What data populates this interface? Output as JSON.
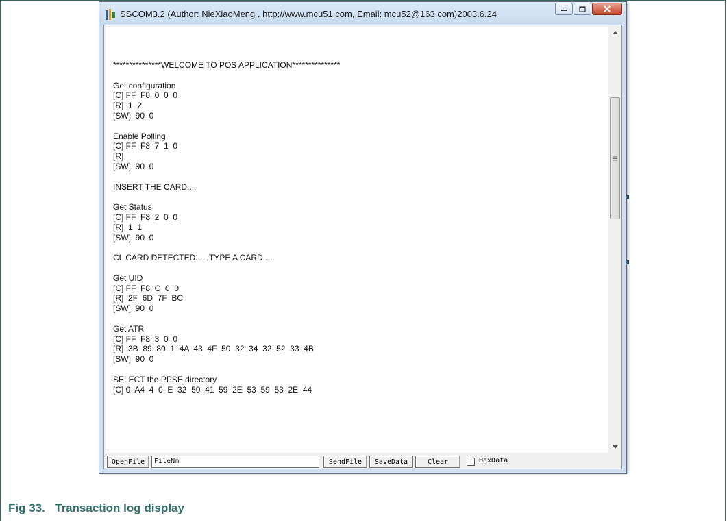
{
  "window": {
    "title": "SSCOM3.2 (Author: NieXiaoMeng .  http://www.mcu51.com,  Email: mcu52@163.com)2003.6.24"
  },
  "log_lines": [
    "***************WELCOME TO POS APPLICATION***************",
    "",
    "Get configuration",
    "[C] FF  F8  0  0  0",
    "[R]  1  2",
    "[SW]  90  0",
    "",
    "Enable Polling",
    "[C] FF  F8  7  1  0",
    "[R]",
    "[SW]  90  0",
    "",
    "INSERT THE CARD....",
    "",
    "Get Status",
    "[C] FF  F8  2  0  0",
    "[R]  1  1",
    "[SW]  90  0",
    "",
    "CL CARD DETECTED..... TYPE A CARD.....",
    "",
    "Get UID",
    "[C] FF  F8  C  0  0",
    "[R]  2F  6D  7F  BC",
    "[SW]  90  0",
    "",
    "Get ATR",
    "[C] FF  F8  3  0  0",
    "[R]  3B  89  80  1  4A  43  4F  50  32  34  32  52  33  4B",
    "[SW]  90  0",
    "",
    "SELECT the PPSE directory",
    "[C] 0  A4  4  0  E  32  50  41  59  2E  53  59  53  2E  44"
  ],
  "toolbar": {
    "open_file": "OpenFile",
    "file_name_value": "FileNm",
    "send_file": "SendFile",
    "save_data": "SaveData",
    "clear": "Clear",
    "hex_data": "HexData",
    "hex_data_checked": false
  },
  "caption": "Fig 33.   Transaction log display",
  "colors": {
    "caption": "#2e6f67",
    "frame": "#2f6b63",
    "close_button": "#c9432c"
  },
  "icons": [
    "app-icon",
    "minimize-icon",
    "maximize-icon",
    "close-icon",
    "scroll-up-arrow-icon",
    "scroll-down-arrow-icon",
    "scroll-grip-icon"
  ]
}
